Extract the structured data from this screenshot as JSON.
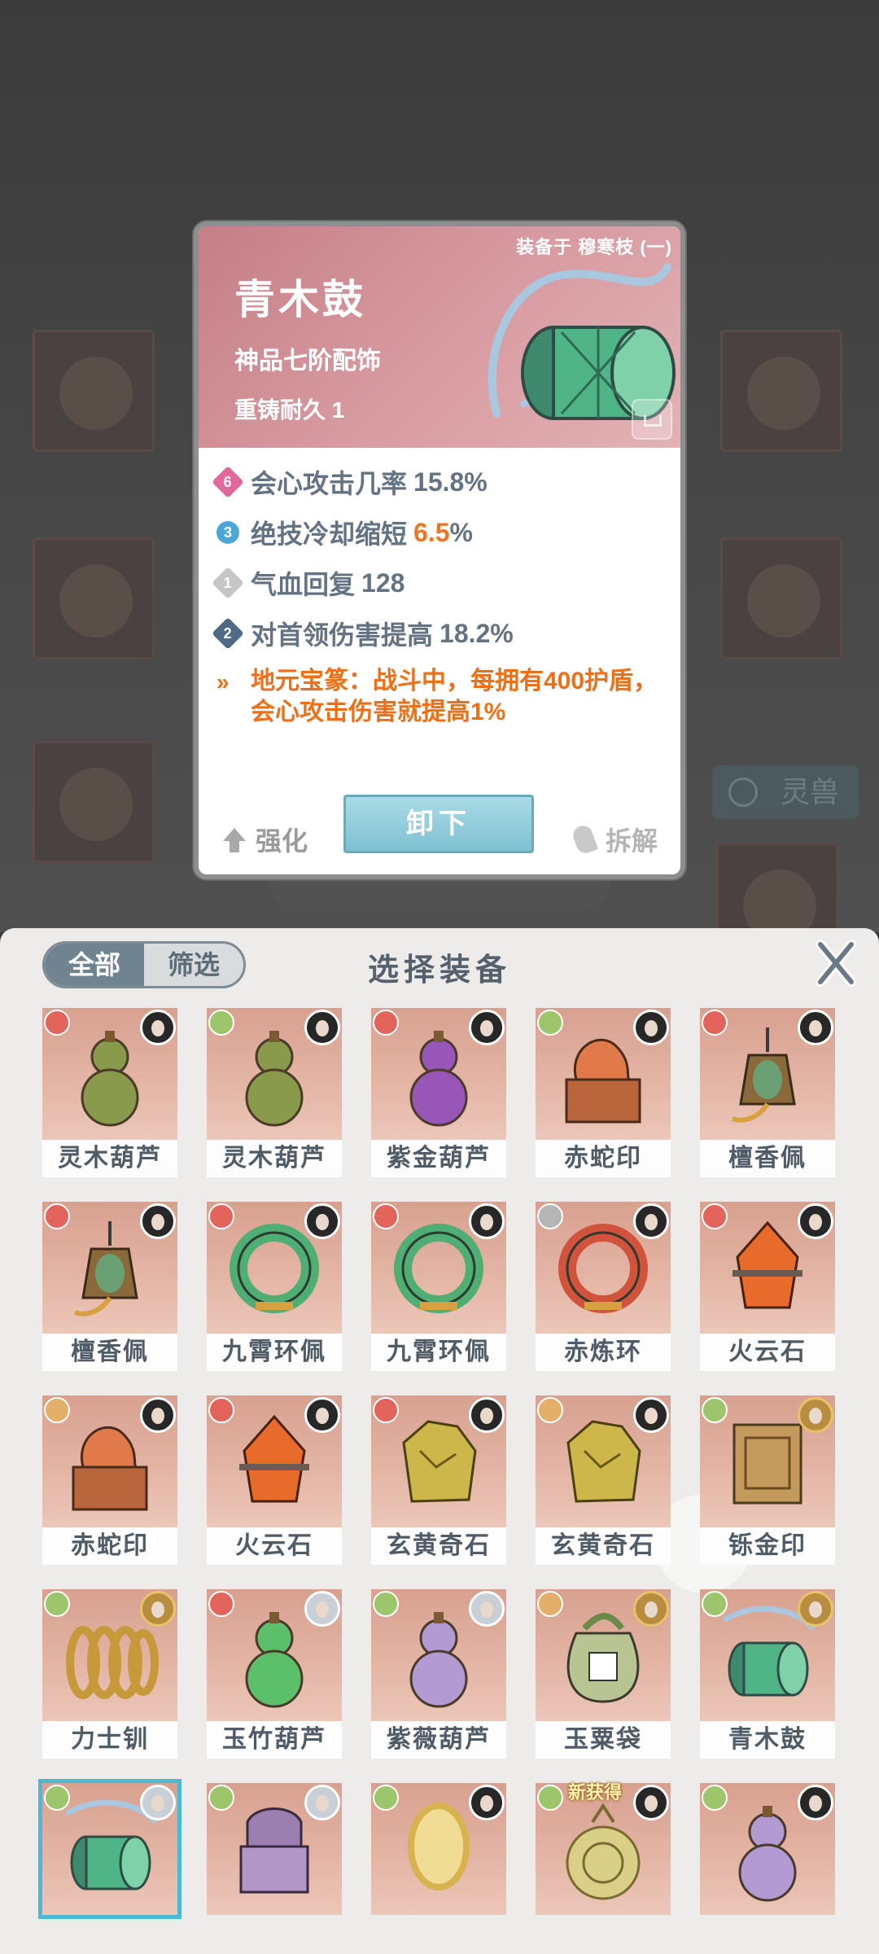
{
  "detail": {
    "equipped_on": "装备于 穆寒枝 (一)",
    "name": "青木鼓",
    "grade": "神品七阶配饰",
    "durability": "重铸耐久 1",
    "stats": [
      {
        "badge": "6",
        "label": "会心攻击几率",
        "value": "15.8%",
        "highlight": false,
        "badge_color": "pink"
      },
      {
        "badge": "3",
        "label": "绝技冷却缩短",
        "value": "6.5",
        "unit": "%",
        "highlight": true,
        "badge_color": "blue"
      },
      {
        "badge": "1",
        "label": "气血回复",
        "value": "128",
        "highlight": false,
        "badge_color": "gray"
      },
      {
        "badge": "2",
        "label": "对首领伤害提高",
        "value": "18.2%",
        "highlight": false,
        "badge_color": "navy"
      }
    ],
    "set_bonus": "地元宝篆：战斗中，每拥有400护盾，会心攻击伤害就提高1%",
    "set_bonus_icon": "double-chevron-icon",
    "enhance_label": "强化",
    "unequip_label": "卸下",
    "dismantle_label": "拆解"
  },
  "background": {
    "spirit_tab": "灵兽"
  },
  "panel": {
    "title": "选择装备",
    "tab_all": "全部",
    "tab_filter": "筛选",
    "items": [
      {
        "name": "灵木葫芦",
        "elem": "red",
        "art": "gourd",
        "color": "#8a9a4c"
      },
      {
        "name": "灵木葫芦",
        "elem": "green",
        "art": "gourd",
        "color": "#8a9a4c"
      },
      {
        "name": "紫金葫芦",
        "elem": "red",
        "art": "gourd",
        "color": "#9857b8"
      },
      {
        "name": "赤蛇印",
        "elem": "green",
        "art": "seal",
        "color": "#e07a4a"
      },
      {
        "name": "檀香佩",
        "elem": "red",
        "art": "pendant",
        "color": "#6aa074"
      },
      {
        "name": "檀香佩",
        "elem": "red",
        "art": "pendant",
        "color": "#6aa074"
      },
      {
        "name": "九霄环佩",
        "elem": "red",
        "art": "ring",
        "color": "#4fae74"
      },
      {
        "name": "九霄环佩",
        "elem": "red",
        "art": "ring",
        "color": "#4fae74"
      },
      {
        "name": "赤炼环",
        "elem": "gray",
        "art": "ring",
        "color": "#d2533c"
      },
      {
        "name": "火云石",
        "elem": "red",
        "art": "crystal",
        "color": "#e86b2c"
      },
      {
        "name": "赤蛇印",
        "elem": "orange",
        "art": "seal",
        "color": "#e07a4a"
      },
      {
        "name": "火云石",
        "elem": "red",
        "art": "crystal",
        "color": "#e86b2c"
      },
      {
        "name": "玄黄奇石",
        "elem": "red",
        "art": "stone",
        "color": "#cdb64a"
      },
      {
        "name": "玄黄奇石",
        "elem": "orange",
        "art": "stone",
        "color": "#cdb64a"
      },
      {
        "name": "铄金印",
        "elem": "green",
        "art": "box",
        "color": "#c49a5c"
      },
      {
        "name": "力士钏",
        "elem": "green",
        "art": "coil",
        "color": "#c69a3a"
      },
      {
        "name": "玉竹葫芦",
        "elem": "red",
        "art": "gourd",
        "color": "#5cbf6a"
      },
      {
        "name": "紫薇葫芦",
        "elem": "green",
        "art": "gourd",
        "color": "#b39ad2"
      },
      {
        "name": "玉粟袋",
        "elem": "orange",
        "art": "bag",
        "color": "#b9c493"
      },
      {
        "name": "青木鼓",
        "elem": "green",
        "art": "drum",
        "color": "#4fb486"
      },
      {
        "name": "",
        "elem": "green",
        "art": "drum",
        "color": "#4fb486",
        "selected": true
      },
      {
        "name": "",
        "elem": "green",
        "art": "censer",
        "color": "#9a7fb0"
      },
      {
        "name": "",
        "elem": "green",
        "art": "mirror",
        "color": "#d8b24e"
      },
      {
        "name": "",
        "elem": "green",
        "art": "disc",
        "color": "#d9cf86",
        "tag": "新获得"
      },
      {
        "name": "",
        "elem": "green",
        "art": "gourd",
        "color": "#b39ad2"
      }
    ]
  }
}
